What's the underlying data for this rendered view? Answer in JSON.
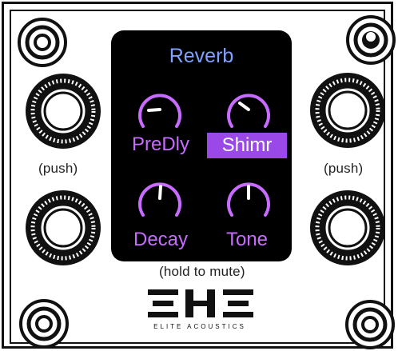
{
  "screen": {
    "title": "Reverb",
    "params": [
      {
        "label": "PreDly",
        "selected": false
      },
      {
        "label": "Shimr",
        "selected": true
      },
      {
        "label": "Decay",
        "selected": false
      },
      {
        "label": "Tone",
        "selected": false
      }
    ]
  },
  "labels": {
    "push_left": "(push)",
    "push_right": "(push)",
    "hold_to_mute": "(hold to mute)"
  },
  "brand": {
    "tagline": "ELITE ACOUSTICS"
  },
  "colors": {
    "screen_bg": "#000000",
    "title": "#7fa2ff",
    "param_text": "#c86bff",
    "selected_bg": "#9a49e8",
    "panel": "#ffffff",
    "ink": "#111111"
  }
}
